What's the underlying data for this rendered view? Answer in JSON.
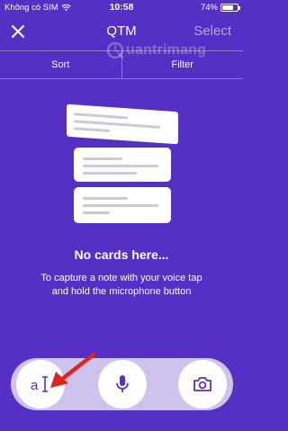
{
  "status_bar": {
    "carrier": "Không có SIM",
    "time": "10:58",
    "battery_percent": "74%",
    "battery_level": 0.74
  },
  "header": {
    "title": "QTM",
    "select_label": "Select",
    "close_icon": "close-icon"
  },
  "watermark": {
    "text": "uantrimang"
  },
  "tabs": [
    {
      "label": "Sort"
    },
    {
      "label": "Filter"
    }
  ],
  "empty_state": {
    "title": "No cards here...",
    "description": "To capture a note with your voice tap and hold the microphone button"
  },
  "bottom_actions": [
    {
      "name": "text-note",
      "icon": "text-cursor-icon",
      "glyph": "a"
    },
    {
      "name": "voice-note",
      "icon": "microphone-icon"
    },
    {
      "name": "photo-note",
      "icon": "camera-icon"
    }
  ],
  "colors": {
    "background": "#5630c4",
    "action_bar": "#cdc3ee",
    "accent_icon": "#5630c4",
    "annotation_arrow": "#e0231c"
  }
}
